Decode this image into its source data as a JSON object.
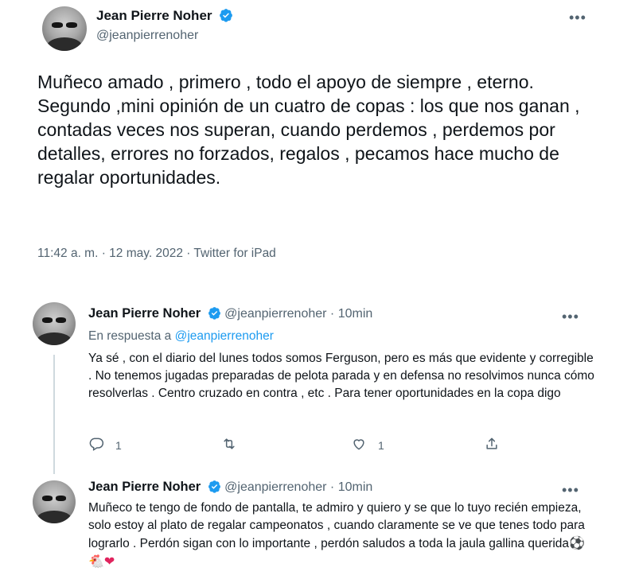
{
  "main_tweet": {
    "name": "Jean Pierre Noher",
    "handle": "@jeanpierrenoher",
    "more": "•••",
    "text": "Muñeco amado , primero , todo el apoyo de siempre , eterno. Segundo ,mini opinión de un cuatro de copas : los que nos ganan , contadas veces nos superan, cuando perdemos , perdemos por detalles, errores no forzados, regalos , pecamos hace mucho de regalar oportunidades.",
    "timestamp": "11:42 a. m. · 12 may. 2022 · Twitter for iPad"
  },
  "replies": [
    {
      "name": "Jean Pierre Noher",
      "handle": "@jeanpierrenoher",
      "time": "· 10min",
      "more": "•••",
      "reply_label": "En respuesta a",
      "reply_handle": "@jeanpierrenoher",
      "text": "Ya sé , con el diario del lunes todos somos Ferguson, pero es más que evidente y corregible . No tenemos jugadas preparadas de pelota parada y en defensa no resolvimos nunca cómo resolverlas . Centro cruzado en contra , etc  . Para tener oportunidades en la copa digo",
      "actions": {
        "reply_count": "1",
        "retweet_count": "",
        "like_count": "1"
      }
    },
    {
      "name": "Jean Pierre Noher",
      "handle": "@jeanpierrenoher",
      "time": "· 10min",
      "more": "•••",
      "text": "Muñeco te tengo de fondo de pantalla, te admiro y quiero y se que lo tuyo recién empieza, solo estoy al plato de regalar campeonatos , cuando claramente se ve que tenes todo para lograrlo . Perdón sigan con lo importante , perdón saludos a toda la jaula gallina querida",
      "emojis": [
        "⚽",
        "🐔",
        "❤"
      ]
    }
  ],
  "colors": {
    "verified": "#1d9bf0",
    "secondary_text": "#536471",
    "link": "#1d9bf0",
    "heart": "#e0245e"
  },
  "icons": [
    "verified-badge-icon",
    "more-icon",
    "reply-icon",
    "retweet-icon",
    "like-icon",
    "share-icon"
  ]
}
